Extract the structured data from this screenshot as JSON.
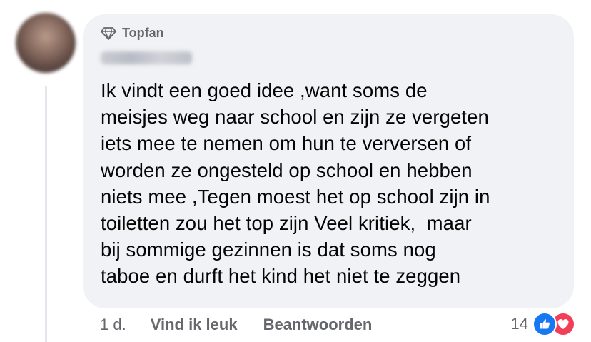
{
  "comment": {
    "badge_label": "Topfan",
    "text": "Ik vindt een goed idee ,want soms de\nmeisjes weg naar school en zijn ze vergeten\niets mee te nemen om hun te verversen of\nworden ze ongesteld op school en hebben\nniets mee ,Tegen moest het op school zijn in\ntoiletten zou het top zijn Veel kritiek,  maar\nbij sommige gezinnen is dat soms nog\ntaboe en durft het kind het niet te zeggen"
  },
  "actions": {
    "timestamp": "1 d.",
    "like_label": "Vind ik leuk",
    "reply_label": "Beantwoorden"
  },
  "reactions": {
    "count": "14",
    "icons": [
      "like-icon",
      "heart-icon"
    ]
  },
  "colors": {
    "bubble": "#f0f2f5",
    "muted_text": "#65676b",
    "like_blue": "#1877f2",
    "love_red": "#f33e58"
  }
}
